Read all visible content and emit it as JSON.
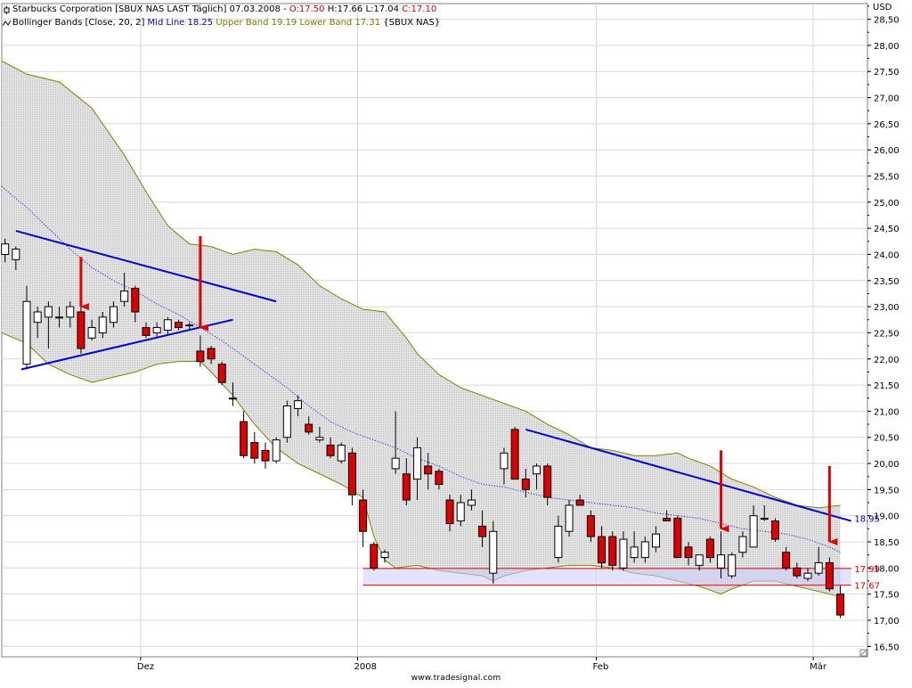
{
  "header": {
    "title": "Starbucks Corporation [SBUX NAS LAST Täglich] 07.03.2008",
    "open": "O:17.50",
    "high": "H:17.66",
    "low": "L:17.04",
    "close": "C:17.10",
    "indicator": "Bollinger Bands [Close, 20, 2]",
    "mid_line": "Mid Line 18.25",
    "upper_band": "Upper Band 19.19",
    "lower_band": "Lower Band 17.31",
    "indicator_symbol": "{SBUX NAS}"
  },
  "currency_label": "USD",
  "watermark": "www.tradesignal.com",
  "colors": {
    "up_candle": "#ffffff",
    "down_candle": "#dd0000",
    "band_fill": "#d4d4d4",
    "band_edge": "#808000",
    "mid_line": "#0000ff",
    "trendline": "#0000cc",
    "arrow": "#e00000",
    "support_zone": "#ccccff",
    "support_line": "#dd0000"
  },
  "chart_data": {
    "type": "candlestick",
    "title": "Starbucks Corporation [SBUX NAS LAST Täglich] 07.03.2008",
    "ylabel": "USD",
    "ylim": [
      16.3,
      28.8
    ],
    "yticks": [
      "16,50",
      "17,00",
      "17,50",
      "18,00",
      "18,50",
      "19,00",
      "19,50",
      "20,00",
      "20,50",
      "21,00",
      "21,50",
      "22,00",
      "22,50",
      "23,00",
      "23,50",
      "24,00",
      "24,50",
      "25,00",
      "25,50",
      "26,00",
      "26,50",
      "27,00",
      "27,50",
      "28,00",
      "28,50"
    ],
    "x_range": [
      -0.3,
      79.5
    ],
    "x_ticks": [
      {
        "label": "Dez",
        "x": 12.5
      },
      {
        "label": "2008",
        "x": 32.5
      },
      {
        "label": "Feb",
        "x": 54.5
      },
      {
        "label": "Mär",
        "x": 74.5
      }
    ],
    "candles": [
      {
        "o": 24.0,
        "h": 24.3,
        "l": 23.85,
        "c": 24.2
      },
      {
        "o": 23.9,
        "h": 24.15,
        "l": 23.7,
        "c": 24.1
      },
      {
        "o": 21.9,
        "h": 23.4,
        "l": 21.8,
        "c": 23.1
      },
      {
        "o": 22.7,
        "h": 23.0,
        "l": 22.4,
        "c": 22.9
      },
      {
        "o": 22.8,
        "h": 23.1,
        "l": 22.2,
        "c": 23.0
      },
      {
        "o": 22.8,
        "h": 23.0,
        "l": 22.6,
        "c": 22.8
      },
      {
        "o": 22.8,
        "h": 23.1,
        "l": 22.6,
        "c": 23.0
      },
      {
        "o": 22.9,
        "h": 23.0,
        "l": 22.1,
        "c": 22.2
      },
      {
        "o": 22.4,
        "h": 22.75,
        "l": 22.35,
        "c": 22.6
      },
      {
        "o": 22.5,
        "h": 22.9,
        "l": 22.4,
        "c": 22.8
      },
      {
        "o": 22.7,
        "h": 23.1,
        "l": 22.6,
        "c": 23.0
      },
      {
        "o": 23.1,
        "h": 23.65,
        "l": 23.0,
        "c": 23.3
      },
      {
        "o": 23.35,
        "h": 23.4,
        "l": 22.7,
        "c": 22.9
      },
      {
        "o": 22.6,
        "h": 22.7,
        "l": 22.4,
        "c": 22.45
      },
      {
        "o": 22.5,
        "h": 22.7,
        "l": 22.4,
        "c": 22.6
      },
      {
        "o": 22.55,
        "h": 22.8,
        "l": 22.45,
        "c": 22.75
      },
      {
        "o": 22.7,
        "h": 22.75,
        "l": 22.55,
        "c": 22.6
      },
      {
        "o": 22.65,
        "h": 22.7,
        "l": 22.55,
        "c": 22.65
      },
      {
        "o": 22.15,
        "h": 22.45,
        "l": 21.85,
        "c": 21.95
      },
      {
        "o": 22.2,
        "h": 22.25,
        "l": 21.9,
        "c": 22.0
      },
      {
        "o": 21.9,
        "h": 21.95,
        "l": 21.5,
        "c": 21.55
      },
      {
        "o": 21.25,
        "h": 21.55,
        "l": 21.1,
        "c": 21.25
      },
      {
        "o": 20.8,
        "h": 21.0,
        "l": 20.1,
        "c": 20.15
      },
      {
        "o": 20.4,
        "h": 20.6,
        "l": 20.0,
        "c": 20.1
      },
      {
        "o": 20.25,
        "h": 20.4,
        "l": 19.9,
        "c": 20.05
      },
      {
        "o": 20.05,
        "h": 20.5,
        "l": 20.0,
        "c": 20.45
      },
      {
        "o": 20.5,
        "h": 21.2,
        "l": 20.4,
        "c": 21.1
      },
      {
        "o": 21.05,
        "h": 21.3,
        "l": 20.9,
        "c": 21.2
      },
      {
        "o": 20.75,
        "h": 20.9,
        "l": 20.55,
        "c": 20.6
      },
      {
        "o": 20.45,
        "h": 20.7,
        "l": 20.4,
        "c": 20.5
      },
      {
        "o": 20.35,
        "h": 20.5,
        "l": 20.1,
        "c": 20.15
      },
      {
        "o": 20.05,
        "h": 20.4,
        "l": 20.0,
        "c": 20.35
      },
      {
        "o": 20.2,
        "h": 20.3,
        "l": 19.2,
        "c": 19.4
      },
      {
        "o": 19.3,
        "h": 19.5,
        "l": 18.4,
        "c": 18.7
      },
      {
        "o": 18.45,
        "h": 18.5,
        "l": 17.95,
        "c": 18.0
      },
      {
        "o": 18.2,
        "h": 18.35,
        "l": 18.1,
        "c": 18.3
      },
      {
        "o": 19.9,
        "h": 21.0,
        "l": 19.8,
        "c": 20.1
      },
      {
        "o": 19.8,
        "h": 20.1,
        "l": 19.2,
        "c": 19.3
      },
      {
        "o": 19.7,
        "h": 20.5,
        "l": 19.3,
        "c": 20.3
      },
      {
        "o": 19.95,
        "h": 20.2,
        "l": 19.5,
        "c": 19.8
      },
      {
        "o": 19.85,
        "h": 19.9,
        "l": 19.5,
        "c": 19.6
      },
      {
        "o": 19.3,
        "h": 19.4,
        "l": 18.7,
        "c": 18.85
      },
      {
        "o": 18.9,
        "h": 19.4,
        "l": 18.8,
        "c": 19.25
      },
      {
        "o": 19.2,
        "h": 19.5,
        "l": 19.1,
        "c": 19.3
      },
      {
        "o": 18.8,
        "h": 19.1,
        "l": 18.4,
        "c": 18.6
      },
      {
        "o": 17.9,
        "h": 18.9,
        "l": 17.7,
        "c": 18.7
      },
      {
        "o": 19.9,
        "h": 20.3,
        "l": 19.6,
        "c": 20.2
      },
      {
        "o": 20.65,
        "h": 20.7,
        "l": 19.8,
        "c": 19.7
      },
      {
        "o": 19.7,
        "h": 19.9,
        "l": 19.35,
        "c": 19.5
      },
      {
        "o": 19.8,
        "h": 20.0,
        "l": 19.5,
        "c": 19.95
      },
      {
        "o": 19.95,
        "h": 20.0,
        "l": 19.2,
        "c": 19.35
      },
      {
        "o": 18.2,
        "h": 19.0,
        "l": 18.1,
        "c": 18.8
      },
      {
        "o": 18.7,
        "h": 19.3,
        "l": 18.6,
        "c": 19.2
      },
      {
        "o": 19.3,
        "h": 19.4,
        "l": 19.2,
        "c": 19.2
      },
      {
        "o": 19.0,
        "h": 19.1,
        "l": 18.5,
        "c": 18.6
      },
      {
        "o": 18.6,
        "h": 18.8,
        "l": 18.0,
        "c": 18.1
      },
      {
        "o": 18.6,
        "h": 18.7,
        "l": 17.95,
        "c": 18.05
      },
      {
        "o": 18.0,
        "h": 18.7,
        "l": 17.95,
        "c": 18.55
      },
      {
        "o": 18.2,
        "h": 18.7,
        "l": 18.1,
        "c": 18.4
      },
      {
        "o": 18.2,
        "h": 18.6,
        "l": 18.1,
        "c": 18.5
      },
      {
        "o": 18.4,
        "h": 18.8,
        "l": 18.3,
        "c": 18.65
      },
      {
        "o": 18.95,
        "h": 19.1,
        "l": 18.9,
        "c": 18.9
      },
      {
        "o": 18.95,
        "h": 19.0,
        "l": 18.2,
        "c": 18.2
      },
      {
        "o": 18.4,
        "h": 18.5,
        "l": 18.05,
        "c": 18.2
      },
      {
        "o": 18.05,
        "h": 18.2,
        "l": 17.95,
        "c": 18.25
      },
      {
        "o": 18.55,
        "h": 18.6,
        "l": 18.1,
        "c": 18.2
      },
      {
        "o": 18.0,
        "h": 18.7,
        "l": 17.8,
        "c": 18.25
      },
      {
        "o": 17.85,
        "h": 18.3,
        "l": 17.8,
        "c": 18.25
      },
      {
        "o": 18.3,
        "h": 18.7,
        "l": 18.2,
        "c": 18.6
      },
      {
        "o": 18.4,
        "h": 19.2,
        "l": 18.4,
        "c": 19.0
      },
      {
        "o": 18.95,
        "h": 19.2,
        "l": 18.9,
        "c": 18.95
      },
      {
        "o": 18.9,
        "h": 18.95,
        "l": 18.5,
        "c": 18.55
      },
      {
        "o": 18.3,
        "h": 18.4,
        "l": 17.95,
        "c": 18.0
      },
      {
        "o": 18.0,
        "h": 18.1,
        "l": 17.8,
        "c": 17.85
      },
      {
        "o": 17.8,
        "h": 18.0,
        "l": 17.75,
        "c": 17.9
      },
      {
        "o": 17.9,
        "h": 18.4,
        "l": 17.85,
        "c": 18.1
      },
      {
        "o": 18.1,
        "h": 18.2,
        "l": 17.55,
        "c": 17.6
      },
      {
        "o": 17.5,
        "h": 17.66,
        "l": 17.04,
        "c": 17.1
      }
    ],
    "bollinger": {
      "params": "Close, 20, 2",
      "upper": [
        [
          -0.3,
          27.7
        ],
        [
          2,
          27.45
        ],
        [
          5,
          27.3
        ],
        [
          8,
          26.8
        ],
        [
          11,
          25.9
        ],
        [
          13,
          25.2
        ],
        [
          15,
          24.55
        ],
        [
          17,
          24.2
        ],
        [
          19,
          24.15
        ],
        [
          21,
          24.0
        ],
        [
          23,
          24.1
        ],
        [
          25,
          24.05
        ],
        [
          27,
          23.8
        ],
        [
          29,
          23.4
        ],
        [
          31,
          23.15
        ],
        [
          33,
          22.95
        ],
        [
          35,
          22.9
        ],
        [
          37,
          22.4
        ],
        [
          38,
          22.1
        ],
        [
          40,
          21.7
        ],
        [
          42,
          21.45
        ],
        [
          44,
          21.3
        ],
        [
          46,
          21.15
        ],
        [
          48,
          21.0
        ],
        [
          50,
          20.75
        ],
        [
          52,
          20.55
        ],
        [
          54,
          20.3
        ],
        [
          56,
          20.25
        ],
        [
          58,
          20.15
        ],
        [
          60,
          20.15
        ],
        [
          62,
          20.2
        ],
        [
          63,
          20.1
        ],
        [
          65,
          19.95
        ],
        [
          67,
          19.7
        ],
        [
          69,
          19.55
        ],
        [
          71,
          19.35
        ],
        [
          73,
          19.2
        ],
        [
          75,
          19.15
        ],
        [
          77,
          19.2
        ]
      ],
      "mid": [
        [
          -0.3,
          25.3
        ],
        [
          2,
          24.9
        ],
        [
          4,
          24.5
        ],
        [
          6,
          24.1
        ],
        [
          8,
          23.75
        ],
        [
          10,
          23.5
        ],
        [
          12,
          23.3
        ],
        [
          14,
          23.05
        ],
        [
          16,
          22.85
        ],
        [
          18,
          22.6
        ],
        [
          20,
          22.35
        ],
        [
          22,
          22.05
        ],
        [
          24,
          21.75
        ],
        [
          26,
          21.45
        ],
        [
          28,
          21.1
        ],
        [
          30,
          20.8
        ],
        [
          32,
          20.6
        ],
        [
          34,
          20.45
        ],
        [
          36,
          20.3
        ],
        [
          38,
          20.1
        ],
        [
          40,
          19.95
        ],
        [
          42,
          19.75
        ],
        [
          44,
          19.6
        ],
        [
          46,
          19.55
        ],
        [
          48,
          19.45
        ],
        [
          50,
          19.35
        ],
        [
          52,
          19.3
        ],
        [
          54,
          19.25
        ],
        [
          56,
          19.2
        ],
        [
          58,
          19.15
        ],
        [
          60,
          19.05
        ],
        [
          62,
          19.0
        ],
        [
          64,
          18.95
        ],
        [
          66,
          18.85
        ],
        [
          68,
          18.75
        ],
        [
          70,
          18.7
        ],
        [
          72,
          18.65
        ],
        [
          74,
          18.55
        ],
        [
          76,
          18.4
        ],
        [
          77,
          18.3
        ]
      ],
      "lower": [
        [
          -0.3,
          22.5
        ],
        [
          2,
          22.3
        ],
        [
          4,
          21.9
        ],
        [
          6,
          21.7
        ],
        [
          8,
          21.55
        ],
        [
          10,
          21.65
        ],
        [
          12,
          21.75
        ],
        [
          14,
          21.9
        ],
        [
          16,
          21.95
        ],
        [
          18,
          21.95
        ],
        [
          19,
          21.75
        ],
        [
          21,
          21.3
        ],
        [
          23,
          20.75
        ],
        [
          25,
          20.3
        ],
        [
          27,
          20.0
        ],
        [
          29,
          19.8
        ],
        [
          31,
          19.6
        ],
        [
          33,
          19.35
        ],
        [
          34,
          18.6
        ],
        [
          35,
          18.15
        ],
        [
          36,
          18.0
        ],
        [
          38,
          18.05
        ],
        [
          40,
          17.95
        ],
        [
          42,
          17.9
        ],
        [
          44,
          17.85
        ],
        [
          45,
          17.75
        ],
        [
          46,
          17.85
        ],
        [
          48,
          17.95
        ],
        [
          50,
          18.0
        ],
        [
          52,
          18.05
        ],
        [
          54,
          18.05
        ],
        [
          56,
          18.0
        ],
        [
          58,
          17.9
        ],
        [
          60,
          17.85
        ],
        [
          62,
          17.75
        ],
        [
          64,
          17.65
        ],
        [
          66,
          17.5
        ],
        [
          67,
          17.6
        ],
        [
          69,
          17.75
        ],
        [
          71,
          17.75
        ],
        [
          73,
          17.65
        ],
        [
          75,
          17.55
        ],
        [
          77,
          17.45
        ]
      ]
    },
    "trendlines": [
      {
        "from": [
          1,
          24.45
        ],
        "to": [
          25,
          23.1
        ]
      },
      {
        "from": [
          1.5,
          21.8
        ],
        "to": [
          21,
          22.75
        ]
      },
      {
        "from": [
          48,
          20.65
        ],
        "to": [
          78,
          18.9
        ]
      }
    ],
    "support_zone": {
      "from_x": 33,
      "to_x": 78,
      "y_low": 17.67,
      "y_high": 17.99
    },
    "level_labels": [
      {
        "text": "17.99",
        "value": 17.99,
        "color": "#dd0000"
      },
      {
        "text": "17.67",
        "value": 17.67,
        "color": "#dd0000"
      },
      {
        "text": "18.95",
        "value": 18.95,
        "color": "#0000cc"
      }
    ],
    "arrows": [
      {
        "x": 7,
        "from": 23.95,
        "to": 23.0
      },
      {
        "x": 18,
        "from": 24.35,
        "to": 22.6
      },
      {
        "x": 66,
        "from": 20.25,
        "to": 18.75
      },
      {
        "x": 76,
        "from": 19.95,
        "to": 18.5
      }
    ],
    "grid": true
  }
}
